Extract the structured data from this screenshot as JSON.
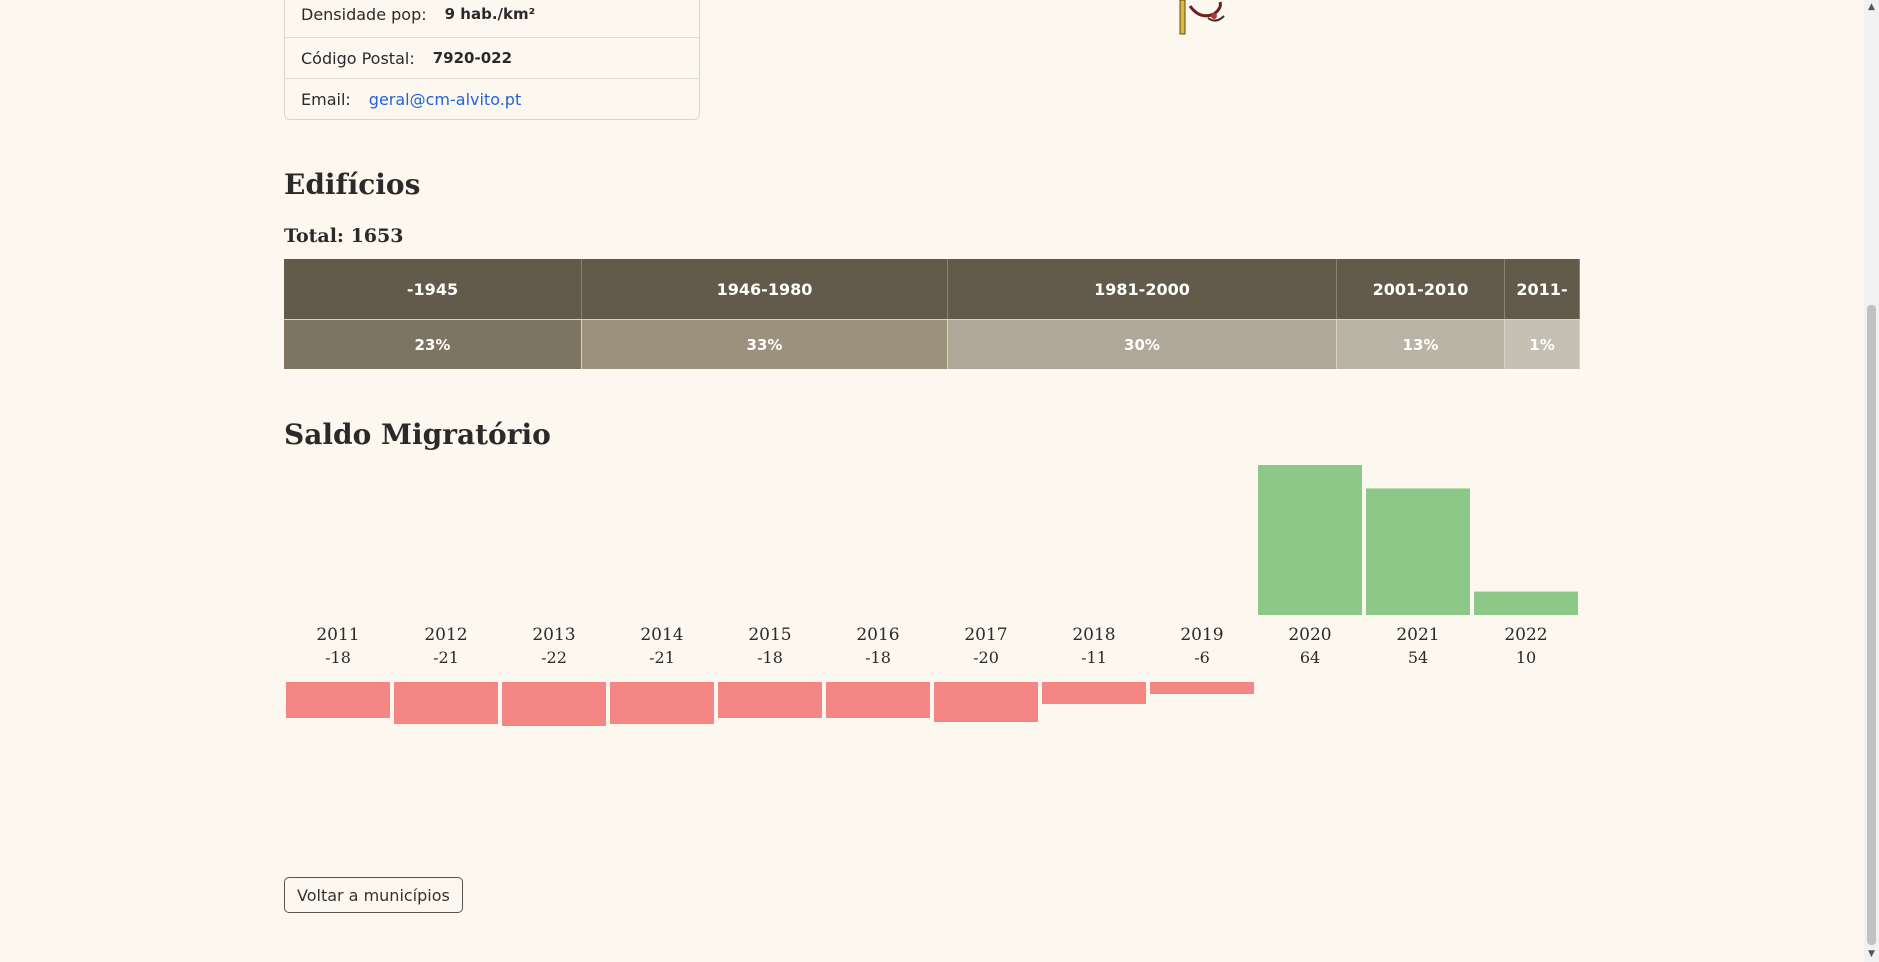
{
  "info": {
    "rows": [
      {
        "label": "Densidade pop:",
        "value": "9 hab./km²"
      },
      {
        "label": "Código Postal:",
        "value": "7920-022"
      },
      {
        "label": "Email:",
        "value": "geral@cm-alvito.pt"
      }
    ]
  },
  "buildings": {
    "title": "Edifícios",
    "total": "Total: 1653",
    "periods": [
      {
        "label": "-1945",
        "value": "23%",
        "share": 23,
        "color": "#7d7462"
      },
      {
        "label": "1946-1980",
        "value": "33%",
        "share": 33,
        "color": "#9b917c"
      },
      {
        "label": "1981-2000",
        "value": "30%",
        "share": 30,
        "color": "#afa898"
      },
      {
        "label": "2001-2010",
        "value": "13%",
        "share": 13,
        "color": "#bab4a7"
      },
      {
        "label": "2011-",
        "value": "1%",
        "share": 1,
        "color": "#c5c0b4"
      }
    ]
  },
  "migration": {
    "title": "Saldo Migratório",
    "positive_color": "#8cc988",
    "negative_color": "#f48684"
  },
  "chart_data": {
    "type": "bar",
    "title": "Saldo Migratório",
    "categories": [
      "2011",
      "2012",
      "2013",
      "2014",
      "2015",
      "2016",
      "2017",
      "2018",
      "2019",
      "2020",
      "2021",
      "2022"
    ],
    "values": [
      -18,
      -21,
      -22,
      -21,
      -18,
      -18,
      -20,
      -11,
      -6,
      64,
      54,
      10
    ],
    "value_labels": [
      "-18",
      "-21",
      "-22",
      "-21",
      "-18",
      "-18",
      "-20",
      "-11",
      "-6",
      "64",
      "54",
      "10"
    ]
  },
  "back_button": {
    "label": "Voltar a municípios"
  }
}
